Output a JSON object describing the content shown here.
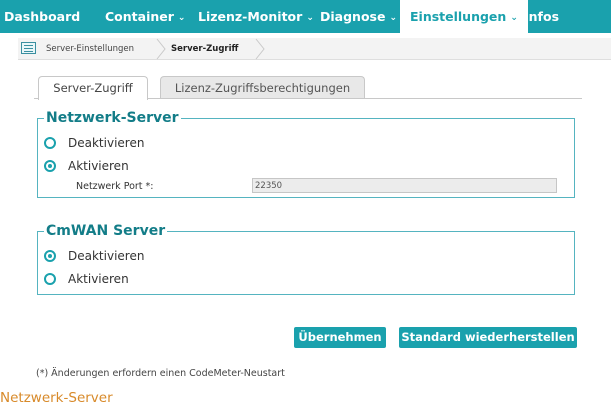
{
  "nav": {
    "dashboard": "Dashboard",
    "container": "Container",
    "lizenz_monitor": "Lizenz-Monitor",
    "diagnose": "Diagnose",
    "einstellungen": "Einstellungen",
    "infos": "Infos",
    "chevron": "⌄"
  },
  "breadcrumb": {
    "items": [
      "Server-Einstellungen",
      "Server-Zugriff"
    ]
  },
  "tabs": [
    "Server-Zugriff",
    "Lizenz-Zugriffsberechtigungen"
  ],
  "netzwerk_server": {
    "legend": "Netzwerk-Server",
    "option_off": "Deaktivieren",
    "option_on": "Aktivieren",
    "selected": "Aktivieren",
    "port_label": "Netzwerk Port *:",
    "port_value": "22350"
  },
  "cmwan_server": {
    "legend": "CmWAN Server",
    "option_off": "Deaktivieren",
    "option_on": "Aktivieren",
    "selected": "Deaktivieren"
  },
  "buttons": {
    "apply": "Übernehmen",
    "restore": "Standard wiederherstellen"
  },
  "footnote": "(*) Änderungen erfordern einen CodeMeter-Neustart",
  "caption": "Netzwerk-Server",
  "colors": {
    "accent": "#1aa1ad",
    "legend_text": "#137d88",
    "caption_text": "#d88a2a"
  }
}
